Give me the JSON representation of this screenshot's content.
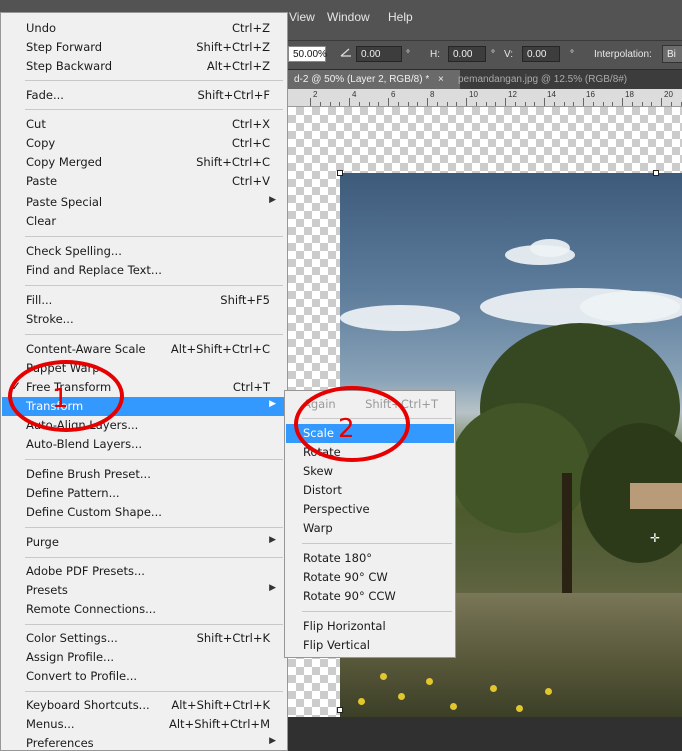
{
  "menubar": {
    "items": [
      "View",
      "Window",
      "Help"
    ]
  },
  "options_bar": {
    "scale_value": "50.00%",
    "angle_icon": "angle-icon",
    "angle_value": "0.00",
    "angle_unit": "°",
    "h_label": "H:",
    "h_value": "0.00",
    "h_unit": "°",
    "v_label": "V:",
    "v_value": "0.00",
    "v_unit": "°",
    "interpolation_label": "Interpolation:",
    "interpolation_value": "Bi"
  },
  "doc_tabs": [
    {
      "label": "d-2 @ 50% (Layer 2, RGB/8) *",
      "close": "×"
    },
    {
      "label": "pemandangan.jpg @ 12.5% (RGB/8#)"
    }
  ],
  "ruler": {
    "labels": [
      "2",
      "4",
      "6",
      "8",
      "10",
      "12",
      "14",
      "16",
      "18",
      "20"
    ]
  },
  "edit_menu": {
    "items": [
      {
        "label": "Undo",
        "shortcut": "Ctrl+Z"
      },
      {
        "label": "Step Forward",
        "shortcut": "Shift+Ctrl+Z"
      },
      {
        "label": "Step Backward",
        "shortcut": "Alt+Ctrl+Z"
      },
      {
        "label": "Fade...",
        "shortcut": "Shift+Ctrl+F"
      },
      {
        "label": "Cut",
        "shortcut": "Ctrl+X"
      },
      {
        "label": "Copy",
        "shortcut": "Ctrl+C"
      },
      {
        "label": "Copy Merged",
        "shortcut": "Shift+Ctrl+C"
      },
      {
        "label": "Paste",
        "shortcut": "Ctrl+V"
      },
      {
        "label": "Paste Special",
        "shortcut": ""
      },
      {
        "label": "Clear",
        "shortcut": ""
      },
      {
        "label": "Check Spelling...",
        "shortcut": ""
      },
      {
        "label": "Find and Replace Text...",
        "shortcut": ""
      },
      {
        "label": "Fill...",
        "shortcut": "Shift+F5"
      },
      {
        "label": "Stroke...",
        "shortcut": ""
      },
      {
        "label": "Content-Aware Scale",
        "shortcut": "Alt+Shift+Ctrl+C"
      },
      {
        "label": "Puppet Warp",
        "shortcut": ""
      },
      {
        "label": "Free Transform",
        "shortcut": "Ctrl+T",
        "check": "✓"
      },
      {
        "label": "Transform",
        "shortcut": ""
      },
      {
        "label": "Auto-Align Layers...",
        "shortcut": ""
      },
      {
        "label": "Auto-Blend Layers...",
        "shortcut": ""
      },
      {
        "label": "Define Brush Preset...",
        "shortcut": ""
      },
      {
        "label": "Define Pattern...",
        "shortcut": ""
      },
      {
        "label": "Define Custom Shape...",
        "shortcut": ""
      },
      {
        "label": "Purge",
        "shortcut": ""
      },
      {
        "label": "Adobe PDF Presets...",
        "shortcut": ""
      },
      {
        "label": "Presets",
        "shortcut": ""
      },
      {
        "label": "Remote Connections...",
        "shortcut": ""
      },
      {
        "label": "Color Settings...",
        "shortcut": "Shift+Ctrl+K"
      },
      {
        "label": "Assign Profile...",
        "shortcut": ""
      },
      {
        "label": "Convert to Profile...",
        "shortcut": ""
      },
      {
        "label": "Keyboard Shortcuts...",
        "shortcut": "Alt+Shift+Ctrl+K"
      },
      {
        "label": "Menus...",
        "shortcut": "Alt+Shift+Ctrl+M"
      },
      {
        "label": "Preferences",
        "shortcut": ""
      }
    ]
  },
  "transform_submenu": {
    "items": [
      {
        "label": "Again",
        "shortcut": "Shift+Ctrl+T"
      },
      {
        "label": "Scale",
        "shortcut": ""
      },
      {
        "label": "Rotate",
        "shortcut": ""
      },
      {
        "label": "Skew",
        "shortcut": ""
      },
      {
        "label": "Distort",
        "shortcut": ""
      },
      {
        "label": "Perspective",
        "shortcut": ""
      },
      {
        "label": "Warp",
        "shortcut": ""
      },
      {
        "label": "Rotate 180°",
        "shortcut": ""
      },
      {
        "label": "Rotate 90° CW",
        "shortcut": ""
      },
      {
        "label": "Rotate 90° CCW",
        "shortcut": ""
      },
      {
        "label": "Flip Horizontal",
        "shortcut": ""
      },
      {
        "label": "Flip Vertical",
        "shortcut": ""
      }
    ]
  },
  "annotations": {
    "step1": "1",
    "step2": "2"
  },
  "colors": {
    "highlight": "#3399ff",
    "annotation": "#e60000",
    "menu_bg": "#f0f0f0",
    "app_bg": "#535353"
  }
}
